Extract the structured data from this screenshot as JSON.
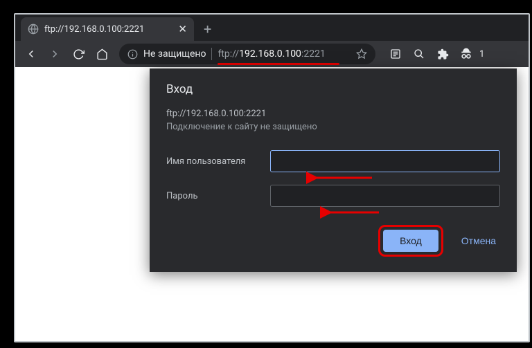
{
  "tab": {
    "title": "ftp://192.168.0.100:2221"
  },
  "toolbar": {
    "security_label": "Не защищено",
    "url_scheme": "ftp://",
    "url_host": "192.168.0.100",
    "url_port": ":2221"
  },
  "dialog": {
    "title": "Вход",
    "url_line": "ftp://192.168.0.100:2221",
    "insecure_line": "Подключение к сайту не защищено",
    "username_label": "Имя пользователя",
    "password_label": "Пароль",
    "username_value": "",
    "password_value": "",
    "login_button": "Вход",
    "cancel_button": "Отмена"
  },
  "annotations": {
    "url_underline_color": "#e60000",
    "arrow_color": "#e60000",
    "login_highlight_color": "#e60000"
  }
}
